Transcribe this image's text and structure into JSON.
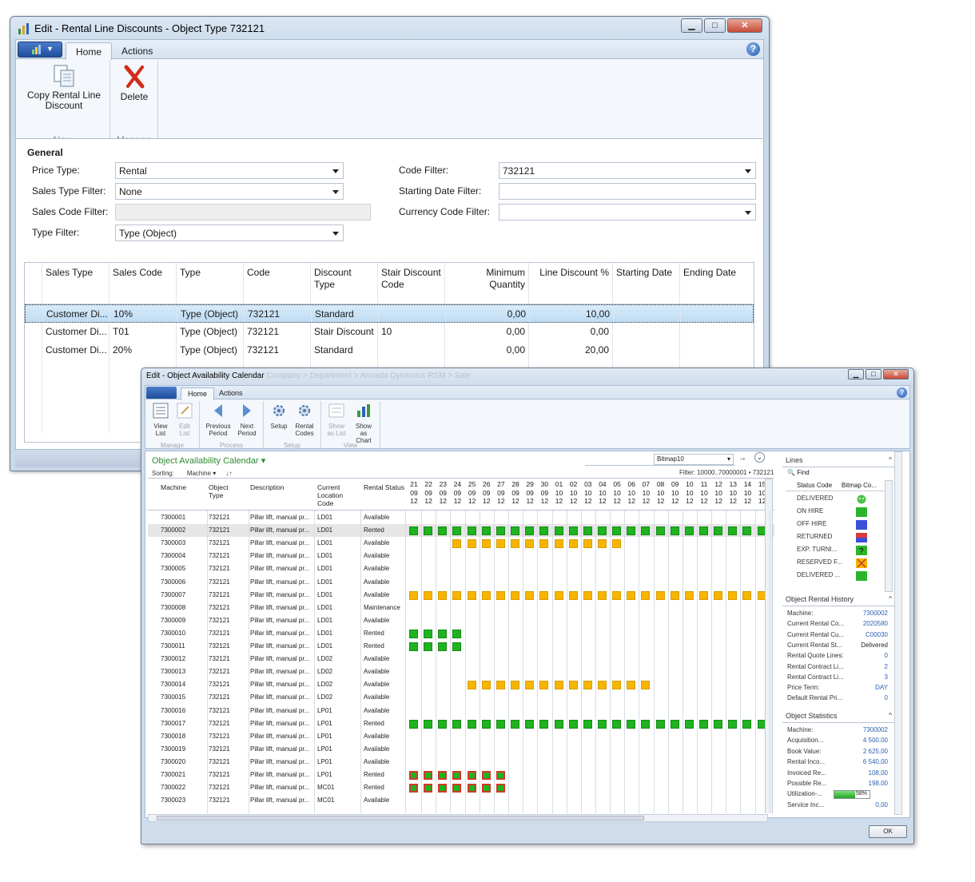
{
  "win1": {
    "title": "Edit - Rental Line Discounts - Object Type 732121",
    "tabs": [
      "Home",
      "Actions"
    ],
    "ribbon": {
      "copy_label_1": "Copy Rental Line",
      "copy_label_2": "Discount",
      "delete_label": "Delete",
      "group_new": "New",
      "group_manage": "Manage"
    },
    "general": {
      "section": "General",
      "price_type_label": "Price Type:",
      "price_type_value": "Rental",
      "sales_type_filter_label": "Sales Type Filter:",
      "sales_type_filter_value": "None",
      "sales_code_filter_label": "Sales Code Filter:",
      "type_filter_label": "Type Filter:",
      "type_filter_value": "Type (Object)",
      "code_filter_label": "Code Filter:",
      "code_filter_value": "732121",
      "starting_date_filter_label": "Starting Date Filter:",
      "currency_code_filter_label": "Currency Code Filter:"
    },
    "grid": {
      "headers": [
        "Sales Type",
        "Sales Code",
        "Type",
        "Code",
        "Discount Type",
        "Stair Discount Code",
        "Minimum Quantity",
        "Line Discount %",
        "Starting Date",
        "Ending Date"
      ],
      "rows": [
        [
          "Customer Di...",
          "10%",
          "Type (Object)",
          "732121",
          "Standard",
          "",
          "0,00",
          "10,00",
          "",
          ""
        ],
        [
          "Customer Di...",
          "T01",
          "Type (Object)",
          "732121",
          "Stair Discount",
          "10",
          "0,00",
          "0,00",
          "",
          ""
        ],
        [
          "Customer Di...",
          "20%",
          "Type (Object)",
          "732121",
          "Standard",
          "",
          "0,00",
          "20,00",
          "",
          ""
        ]
      ]
    }
  },
  "win2": {
    "title": "Edit - Object Availability Calendar",
    "title_crumbs": "Company  >  Department  >  Armada Dynamics RSM  >  Sale",
    "tabs": [
      "Home",
      "Actions"
    ],
    "ribbon": {
      "view_list": "View\nList",
      "edit_list": "Edit\nList",
      "prev_period": "Previous\nPeriod",
      "next_period": "Next\nPeriod",
      "setup": "Setup",
      "rental_codes": "Rental\nCodes",
      "show_as_list": "Show\nas List",
      "show_as_chart": "Show as\nChart",
      "groups": [
        "Manage",
        "Process",
        "Setup",
        "View"
      ]
    },
    "page_title": "Object Availability Calendar",
    "bitmap": "Bitmap10",
    "filter": "Filter: 10000..70000001 • 732121",
    "sorting_label": "Sorting:",
    "sorting_value": "Machine",
    "headers": {
      "machine": "Machine",
      "object_type": "Object\nType",
      "description": "Description",
      "location": "Current\nLocation\nCode",
      "status": "Rental Status"
    },
    "dates": [
      [
        "21",
        "09",
        "12"
      ],
      [
        "22",
        "09",
        "12"
      ],
      [
        "23",
        "09",
        "12"
      ],
      [
        "24",
        "09",
        "12"
      ],
      [
        "25",
        "09",
        "12"
      ],
      [
        "26",
        "09",
        "12"
      ],
      [
        "27",
        "09",
        "12"
      ],
      [
        "28",
        "09",
        "12"
      ],
      [
        "29",
        "09",
        "12"
      ],
      [
        "30",
        "09",
        "12"
      ],
      [
        "01",
        "10",
        "12"
      ],
      [
        "02",
        "10",
        "12"
      ],
      [
        "03",
        "10",
        "12"
      ],
      [
        "04",
        "10",
        "12"
      ],
      [
        "05",
        "10",
        "12"
      ],
      [
        "06",
        "10",
        "12"
      ],
      [
        "07",
        "10",
        "12"
      ],
      [
        "08",
        "10",
        "12"
      ],
      [
        "09",
        "10",
        "12"
      ],
      [
        "10",
        "10",
        "12"
      ],
      [
        "11",
        "10",
        "12"
      ],
      [
        "12",
        "10",
        "12"
      ],
      [
        "13",
        "10",
        "12"
      ],
      [
        "14",
        "10",
        "12"
      ],
      [
        "15",
        "10",
        "12"
      ]
    ],
    "rows": [
      {
        "m": "7300001",
        "t": "732121",
        "d": "Pillar lift, manual pr...",
        "l": "LD01",
        "s": "Available",
        "marks": ""
      },
      {
        "m": "7300002",
        "t": "732121",
        "d": "Pillar lift, manual pr...",
        "l": "LD01",
        "s": "Rented",
        "marks": "ggggggggggggggggggggggggg"
      },
      {
        "m": "7300003",
        "t": "732121",
        "d": "Pillar lift, manual pr...",
        "l": "LD01",
        "s": "Available",
        "marks": "...yyyyyyyyyyyy"
      },
      {
        "m": "7300004",
        "t": "732121",
        "d": "Pillar lift, manual pr...",
        "l": "LD01",
        "s": "Available",
        "marks": ""
      },
      {
        "m": "7300005",
        "t": "732121",
        "d": "Pillar lift, manual pr...",
        "l": "LD01",
        "s": "Available",
        "marks": ""
      },
      {
        "m": "7300006",
        "t": "732121",
        "d": "Pillar lift, manual pr...",
        "l": "LD01",
        "s": "Available",
        "marks": ""
      },
      {
        "m": "7300007",
        "t": "732121",
        "d": "Pillar lift, manual pr...",
        "l": "LD01",
        "s": "Available",
        "marks": "yyyyyyyyyyyyyyyyyyyyyyyyy"
      },
      {
        "m": "7300008",
        "t": "732121",
        "d": "Pillar lift, manual pr...",
        "l": "LD01",
        "s": "Maintenance",
        "marks": ""
      },
      {
        "m": "7300009",
        "t": "732121",
        "d": "Pillar lift, manual pr...",
        "l": "LD01",
        "s": "Available",
        "marks": ""
      },
      {
        "m": "7300010",
        "t": "732121",
        "d": "Pillar lift, manual pr...",
        "l": "LD01",
        "s": "Rented",
        "marks": "gggg"
      },
      {
        "m": "7300011",
        "t": "732121",
        "d": "Pillar lift, manual pr...",
        "l": "LD01",
        "s": "Rented",
        "marks": "gggg"
      },
      {
        "m": "7300012",
        "t": "732121",
        "d": "Pillar lift, manual pr...",
        "l": "LD02",
        "s": "Available",
        "marks": ""
      },
      {
        "m": "7300013",
        "t": "732121",
        "d": "Pillar lift, manual pr...",
        "l": "LD02",
        "s": "Available",
        "marks": ""
      },
      {
        "m": "7300014",
        "t": "732121",
        "d": "Pillar lift, manual pr...",
        "l": "LD02",
        "s": "Available",
        "marks": "....yyyyyyyyyyyyy"
      },
      {
        "m": "7300015",
        "t": "732121",
        "d": "Pillar lift, manual pr...",
        "l": "LD02",
        "s": "Available",
        "marks": ""
      },
      {
        "m": "7300016",
        "t": "732121",
        "d": "Pillar lift, manual pr...",
        "l": "LP01",
        "s": "Available",
        "marks": ""
      },
      {
        "m": "7300017",
        "t": "732121",
        "d": "Pillar lift, manual pr...",
        "l": "LP01",
        "s": "Rented",
        "marks": "ggggggggggggggggggggggggg"
      },
      {
        "m": "7300018",
        "t": "732121",
        "d": "Pillar lift, manual pr...",
        "l": "LP01",
        "s": "Available",
        "marks": ""
      },
      {
        "m": "7300019",
        "t": "732121",
        "d": "Pillar lift, manual pr...",
        "l": "LP01",
        "s": "Available",
        "marks": ""
      },
      {
        "m": "7300020",
        "t": "732121",
        "d": "Pillar lift, manual pr...",
        "l": "LP01",
        "s": "Available",
        "marks": ""
      },
      {
        "m": "7300021",
        "t": "732121",
        "d": "Pillar lift, manual pr...",
        "l": "LP01",
        "s": "Rented",
        "marks": "rrrrrrr"
      },
      {
        "m": "7300022",
        "t": "732121",
        "d": "Pillar lift, manual pr...",
        "l": "MC01",
        "s": "Rented",
        "marks": "rrrrrrr"
      },
      {
        "m": "7300023",
        "t": "732121",
        "d": "Pillar lift, manual pr...",
        "l": "MC01",
        "s": "Available",
        "marks": ""
      }
    ],
    "lines_box": {
      "title": "Lines",
      "find": "Find",
      "col1": "Status Code",
      "col2": "Bitmap Co...",
      "items": [
        "DELIVERED",
        "ON HIRE",
        "OFF HIRE",
        "RETURNED",
        "EXP. TURNI...",
        "RESERVED F...",
        "DELIVERED ..."
      ]
    },
    "history_box": {
      "title": "Object Rental History",
      "rows": [
        [
          "Machine:",
          "7300002"
        ],
        [
          "Current Rental Co...",
          "2020580"
        ],
        [
          "Current Rental Cu...",
          "C00030"
        ],
        [
          "Current Rental St...",
          "Delivered"
        ],
        [
          "Rental Quote Lines:",
          "0"
        ],
        [
          "Rental Contract Li...",
          "2"
        ],
        [
          "Rental Contract Li...",
          "3"
        ],
        [
          "Price Term:",
          "DAY"
        ],
        [
          "Default Rental Pri...",
          "0"
        ]
      ]
    },
    "stats_box": {
      "title": "Object Statistics",
      "rows": [
        [
          "Machine:",
          "7300002"
        ],
        [
          "Acquisition...",
          "4 500,00"
        ],
        [
          "Book Value:",
          "2 625,00"
        ],
        [
          "Rental Inco...",
          "6 540,00"
        ],
        [
          "Invoiced Re...",
          "108,00"
        ],
        [
          "Possible Re...",
          "198,00"
        ],
        [
          "Utilization-...",
          ""
        ],
        [
          "Service Inc...",
          "0,00"
        ]
      ],
      "utilization": "58%",
      "utilization_fraction": 0.58
    },
    "ok_label": "OK"
  }
}
